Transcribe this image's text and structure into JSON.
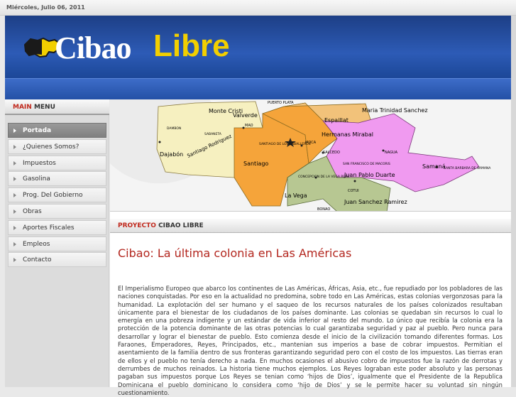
{
  "topbar": {
    "date": "Miércoles, Julio 06, 2011"
  },
  "header": {
    "logo_part1": "Cibao",
    "logo_part2": "Libre"
  },
  "sidebar": {
    "title_accent": "MAIN",
    "title_rest": "MENU",
    "items": [
      {
        "label": "Portada",
        "active": true
      },
      {
        "label": "¿Quienes Somos?"
      },
      {
        "label": "Impuestos"
      },
      {
        "label": "Gasolina"
      },
      {
        "label": "Prog. Del Gobierno"
      },
      {
        "label": "Obras"
      },
      {
        "label": "Aportes Fiscales"
      },
      {
        "label": "Empleos"
      },
      {
        "label": "Contacto"
      }
    ]
  },
  "map": {
    "labels": {
      "monte_cristi": "Monte Cristi",
      "valverde": "Valverde",
      "espaillat": "Espaillat",
      "maria_trinidad": "Maria Trinidad Sanchez",
      "hermanas": "Hermanas Mirabal",
      "dajabon": "Dajabón",
      "santiago_rodriguez": "Santiago Rodriguez",
      "santiago": "Santiago",
      "samana": "Samaná",
      "juan_pablo": "Juan Pablo Duarte",
      "la_vega": "La Vega",
      "juan_sanchez": "Juan Sanchez Ramirez",
      "puerto_plata": "PUERTO PLATA",
      "moca": "MOCA",
      "salcedo": "SALCEDO",
      "nagua": "NAGUA",
      "mao": "MAO",
      "sf_macoris": "SAN FRANCISCO DE MACORIS",
      "concepcion": "CONCEPCION DE LA VEGA REAL",
      "cotui": "COTUI",
      "bonao": "BONAO",
      "santa_barbara": "SANTA BARBARA DE SAMANA",
      "sabaneta": "SABANETA",
      "santiago_cab": "SANTIAGO DE LOS CABALLEROS",
      "dajabon_small": "DAMBON"
    }
  },
  "section": {
    "accent": "PROYECTO",
    "rest": "CIBAO LIBRE"
  },
  "article": {
    "title": "Cibao: La última colonia en Las Américas",
    "lines": [
      "El Imperialismo Europeo que abarco los continentes de Las Américas, Áfricas, Asia, etc., fue repudiado por los pobladores de las naciones conquistadas. Por eso en la actualidad no predomina, sobre todo en Las Américas, estas colonias vergonzosas para la humanidad. La explotación del ser humano y el saqueo de los recursos naturales de los países colonizados resultaban únicamente para el bienestar de los ciudadanos de los países dominante. Las colonias se quedaban sin recursos lo cual lo emergía en una pobreza indigente y un estándar de vida inferior al resto del mundo. Lo único que recibía la colonia era la protección de la potencia dominante de las otras potencias lo cual garantizaba seguridad y paz al pueblo. Pero nunca para desarrollar y lograr el bienestar de pueblo. Esto comienza desde el inicio de la civilización tomando diferentes formas. Los Faraones, Emperadores, Reyes, Principados, etc., mantenian sus imperios a base de cobrar impuestos. Permitian el asentamiento de la familia dentro de sus fronteras garantizando seguridad pero con el costo de los impuestos. Las tierras eran de ellos y el pueblo no tenía derecho a nada. En muchos ocasiones el abusivo cobro de impuestos fue la razón de derrotas y derrumbes  de muchos reinados. La historia tiene muchos ejemplos. Los Reyes lograban este poder absoluto y las personas pagaban sus impuestos porque Los Reyes se tenian como ‘hijos de Dios’, igualmente que el Presidente de la Republica Dominicana el pueblo dominicano lo considera como ‘hijo de Dios’ y se le permite hacer su voluntad sin ningún cuestionamiento."
    ]
  },
  "colors": {
    "accent_red": "#c0281c",
    "header_blue": "#2d5bb6",
    "logo_yellow": "#f2cf00",
    "region_cream": "#f6f0c0",
    "region_orange": "#f5a43a",
    "region_pink": "#f09af0",
    "region_green": "#b7c792"
  }
}
